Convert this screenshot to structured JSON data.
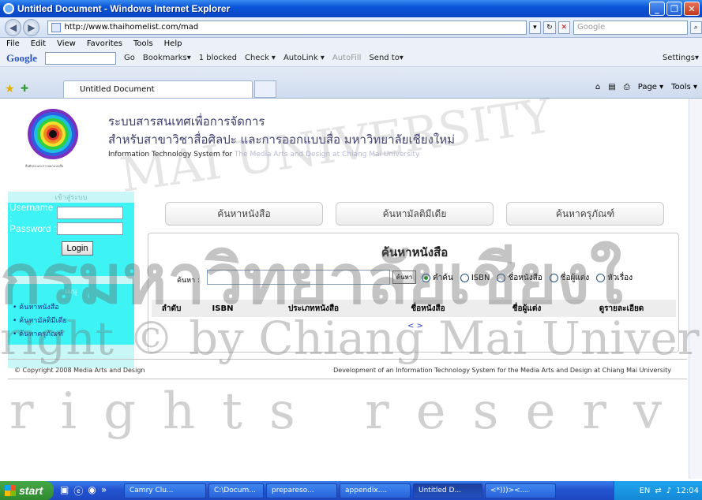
{
  "window": {
    "title": "Untitled Document - Windows Internet Explorer",
    "minimize": "_",
    "maximize": "❐",
    "close": "✕"
  },
  "address": {
    "url": "http://www.thaihomelist.com/mad",
    "search_placeholder": "Google"
  },
  "menu": [
    "File",
    "Edit",
    "View",
    "Favorites",
    "Tools",
    "Help"
  ],
  "google_toolbar": {
    "logo": "Google",
    "items": [
      "Go",
      "Bookmarks▾",
      "1 blocked",
      "Check ▾",
      "AutoLink ▾",
      "AutoFill",
      "Send to▾"
    ],
    "settings": "Settings▾"
  },
  "tab": {
    "label": "Untitled Document",
    "tools": [
      "Page ▾",
      "Tools ▾"
    ]
  },
  "header": {
    "line1": "ระบบสารสนเทศเพื่อการจัดการ",
    "line2": "สำหรับสาขาวิชาสื่อศิลปะ และการออกแบบสื่อ มหาวิทยาลัยเชียงใหม่",
    "line3_bold": "Information Technology System for",
    "line3_light": "The Media Arts and Design at Chiang Mai University",
    "logo_caption": "สื่อศิลปะและการออกแบบสื่อ"
  },
  "login": {
    "heading": "เข้าสู่ระบบ",
    "username_label": "Username :",
    "password_label": "Password :",
    "button": "Login"
  },
  "sidemenu": {
    "heading": "เมนู",
    "items": [
      "• ค้นหาหนังสือ",
      "• ค้นหามัลติมีเดีย",
      "• ค้นหาครุภัณฑ์"
    ]
  },
  "topbuttons": [
    "ค้นหาหนังสือ",
    "ค้นหามัลติมีเดีย",
    "ค้นหาครุภัณฑ์"
  ],
  "search_panel": {
    "title": "ค้นหาหนังสือ",
    "label": "ค้นหา :",
    "button": "ค้นหา",
    "options": [
      {
        "label": "คำค้น",
        "checked": true
      },
      {
        "label": "ISBN",
        "checked": false
      },
      {
        "label": "ชื่อหนังสือ",
        "checked": false
      },
      {
        "label": "ชื่อผู้แต่ง",
        "checked": false
      },
      {
        "label": "หัวเรื่อง",
        "checked": false
      }
    ],
    "columns": [
      "ลำดับ",
      "ISBN",
      "ประเภทหนังสือ",
      "ชื่อหนังสือ",
      "ชื่อผู้แต่ง",
      "ดูรายละเอียด"
    ],
    "pager": "< >"
  },
  "footer": {
    "left": "© Copyright 2008 Media Arts and Design",
    "right": "Development of an Information Technology System for the Media Arts and Design at Chiang Mai University"
  },
  "watermark": {
    "thai": "กรมหาวิทยาลัยเชียงใ",
    "copyright": "right © by Chiang Mai Univer",
    "rights": "rights reserv",
    "arc": "MAI UNIVERSITY"
  },
  "taskbar": {
    "start": "start",
    "tasks": [
      "Camry Clu...",
      "C:\\Docum...",
      "prepareso...",
      "appendix....",
      "Untitled D...",
      "<*)))><...."
    ],
    "active_index": 4,
    "lang": "EN",
    "clock": "12:04"
  }
}
